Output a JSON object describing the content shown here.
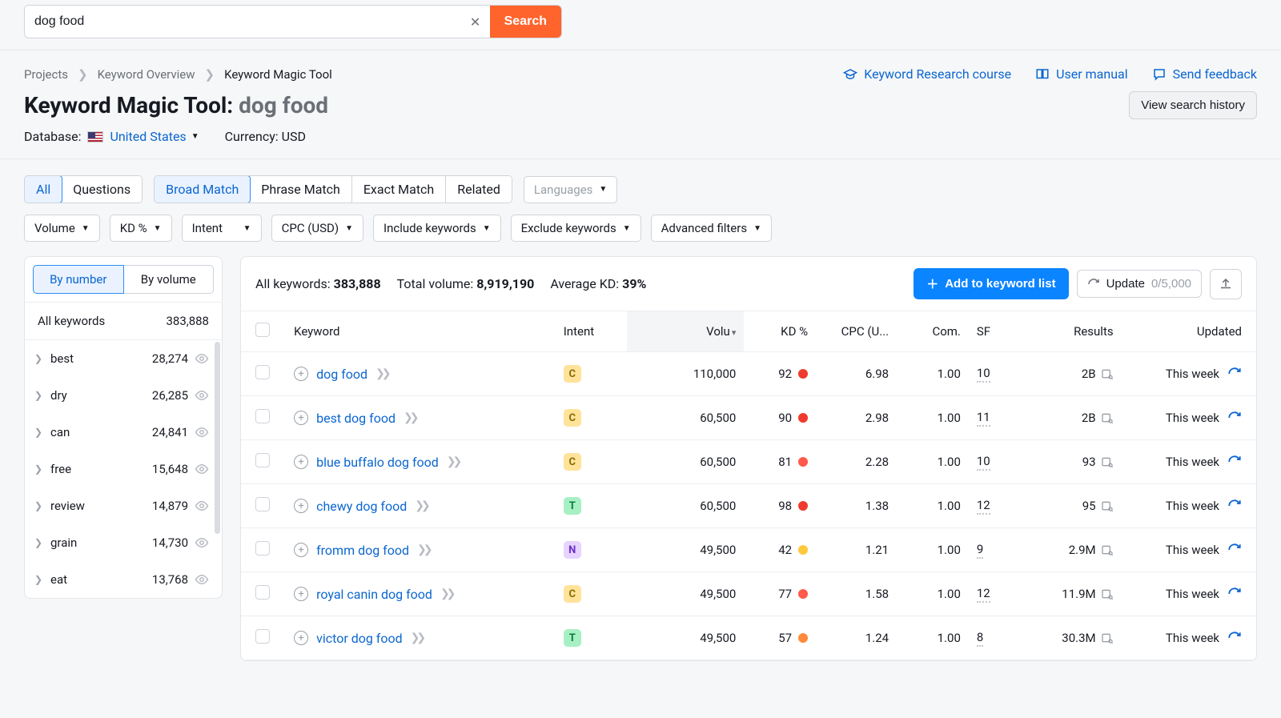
{
  "search": {
    "value": "dog food",
    "button": "Search"
  },
  "breadcrumbs": {
    "projects": "Projects",
    "overview": "Keyword Overview",
    "current": "Keyword Magic Tool"
  },
  "header_links": {
    "course": "Keyword Research course",
    "manual": "User manual",
    "feedback": "Send feedback"
  },
  "title": {
    "tool": "Keyword Magic Tool:",
    "keyword": "dog food",
    "history_btn": "View search history"
  },
  "meta": {
    "db_label": "Database:",
    "country": "United States",
    "currency_label": "Currency:",
    "currency": "USD"
  },
  "tabs1": {
    "all": "All",
    "questions": "Questions"
  },
  "tabs2": {
    "broad": "Broad Match",
    "phrase": "Phrase Match",
    "exact": "Exact Match",
    "related": "Related"
  },
  "lang_chip": "Languages",
  "filters": {
    "volume": "Volume",
    "kd": "KD %",
    "intent": "Intent",
    "cpc": "CPC (USD)",
    "include": "Include keywords",
    "exclude": "Exclude keywords",
    "advanced": "Advanced filters"
  },
  "sidebar": {
    "by_number": "By number",
    "by_volume": "By volume",
    "all_label": "All keywords",
    "all_count": "383,888",
    "items": [
      {
        "label": "best",
        "count": "28,274"
      },
      {
        "label": "dry",
        "count": "26,285"
      },
      {
        "label": "can",
        "count": "24,841"
      },
      {
        "label": "free",
        "count": "15,648"
      },
      {
        "label": "review",
        "count": "14,879"
      },
      {
        "label": "grain",
        "count": "14,730"
      },
      {
        "label": "eat",
        "count": "13,768"
      }
    ]
  },
  "summary": {
    "all_label": "All keywords:",
    "all_value": "383,888",
    "vol_label": "Total volume:",
    "vol_value": "8,919,190",
    "kd_label": "Average KD:",
    "kd_value": "39%",
    "add_btn": "Add to keyword list",
    "update": "Update",
    "update_count": "0/5,000"
  },
  "columns": {
    "keyword": "Keyword",
    "intent": "Intent",
    "volume": "Volu",
    "kd": "KD %",
    "cpc": "CPC (U...",
    "com": "Com.",
    "sf": "SF",
    "results": "Results",
    "updated": "Updated"
  },
  "rows": [
    {
      "keyword": "dog food",
      "intent": "C",
      "volume": "110,000",
      "kd": "92",
      "kd_color": "red",
      "cpc": "6.98",
      "com": "1.00",
      "sf": "10",
      "results": "2B",
      "updated": "This week"
    },
    {
      "keyword": "best dog food",
      "intent": "C",
      "volume": "60,500",
      "kd": "90",
      "kd_color": "red",
      "cpc": "2.98",
      "com": "1.00",
      "sf": "11",
      "results": "2B",
      "updated": "This week"
    },
    {
      "keyword": "blue buffalo dog food",
      "intent": "C",
      "volume": "60,500",
      "kd": "81",
      "kd_color": "lred",
      "cpc": "2.28",
      "com": "1.00",
      "sf": "10",
      "results": "93",
      "updated": "This week"
    },
    {
      "keyword": "chewy dog food",
      "intent": "T",
      "volume": "60,500",
      "kd": "98",
      "kd_color": "red",
      "cpc": "1.38",
      "com": "1.00",
      "sf": "12",
      "results": "95",
      "updated": "This week"
    },
    {
      "keyword": "fromm dog food",
      "intent": "N",
      "volume": "49,500",
      "kd": "42",
      "kd_color": "yellow",
      "cpc": "1.21",
      "com": "1.00",
      "sf": "9",
      "results": "2.9M",
      "updated": "This week"
    },
    {
      "keyword": "royal canin dog food",
      "intent": "C",
      "volume": "49,500",
      "kd": "77",
      "kd_color": "lred",
      "cpc": "1.58",
      "com": "1.00",
      "sf": "12",
      "results": "11.9M",
      "updated": "This week"
    },
    {
      "keyword": "victor dog food",
      "intent": "T",
      "volume": "49,500",
      "kd": "57",
      "kd_color": "orange",
      "cpc": "1.24",
      "com": "1.00",
      "sf": "8",
      "results": "30.3M",
      "updated": "This week"
    }
  ]
}
